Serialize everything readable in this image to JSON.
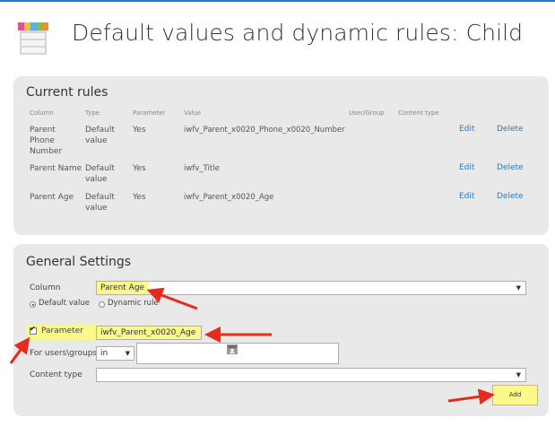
{
  "page": {
    "title": "Default values and dynamic rules: Child"
  },
  "current_rules": {
    "title": "Current rules",
    "columns": [
      "Column",
      "Type",
      "Parameter",
      "Value",
      "User/Group",
      "Content type"
    ],
    "rows": [
      {
        "column": "Parent Phone Number",
        "type": "Default value",
        "parameter": "Yes",
        "value": "iwfv_Parent_x0020_Phone_x0020_Number",
        "user_group": "",
        "content_type": "",
        "edit": "Edit",
        "delete": "Delete"
      },
      {
        "column": "Parent Name",
        "type": "Default value",
        "parameter": "Yes",
        "value": "iwfv_Title",
        "user_group": "",
        "content_type": "",
        "edit": "Edit",
        "delete": "Delete"
      },
      {
        "column": "Parent Age",
        "type": "Default value",
        "parameter": "Yes",
        "value": "iwfv_Parent_x0020_Age",
        "user_group": "",
        "content_type": "",
        "edit": "Edit",
        "delete": "Delete"
      }
    ]
  },
  "general_settings": {
    "title": "General Settings",
    "column_label": "Column",
    "column_value": "Parent Age",
    "radio_default_label": "Default value",
    "radio_dynamic_label": "Dynamic rule",
    "radio_selected": "default",
    "parameter_label": "Parameter",
    "parameter_checked": true,
    "parameter_value": "iwfv_Parent_x0020_Age",
    "users_label": "For users\\groups",
    "users_operator": "in",
    "users_value": "",
    "content_type_label": "Content type",
    "content_type_value": "",
    "add_label": "Add"
  },
  "colors": {
    "highlight": "#fbf98a",
    "arrow": "#e32b1e",
    "link": "#2a78c2",
    "panel": "#e9e9e9"
  },
  "icons": [
    "app-list-icon",
    "people-picker-icon",
    "dropdown-caret-icon"
  ]
}
